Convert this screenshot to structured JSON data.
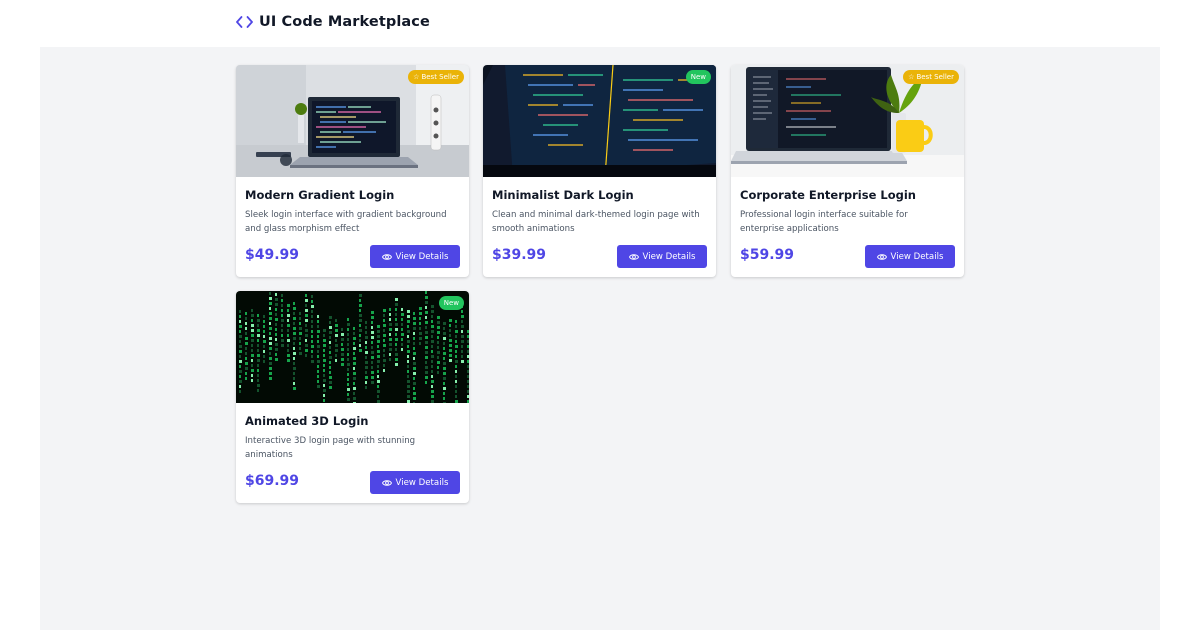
{
  "header": {
    "title": "UI Code Marketplace",
    "icon": "code-icon",
    "accent": "#4f46e5"
  },
  "products": [
    {
      "title": "Modern Gradient Login",
      "description": "Sleek login interface with gradient background and glass morphism effect",
      "price": "$49.99",
      "badge": "Best Seller",
      "badge_icon": "star-icon",
      "button_label": "View Details",
      "button_icon": "eye-icon",
      "image": "laptop-on-desk-photo"
    },
    {
      "title": "Minimalist Dark Login",
      "description": "Clean and minimal dark-themed login page with smooth animations",
      "price": "$39.99",
      "badge": "New",
      "button_label": "View Details",
      "button_icon": "eye-icon",
      "image": "code-on-screen-photo"
    },
    {
      "title": "Corporate Enterprise Login",
      "description": "Professional login interface suitable for enterprise applications",
      "price": "$59.99",
      "badge": "Best Seller",
      "badge_icon": "star-icon",
      "button_label": "View Details",
      "button_icon": "eye-icon",
      "image": "laptop-with-plant-and-mug-photo"
    },
    {
      "title": "Animated 3D Login",
      "description": "Interactive 3D login page with stunning animations",
      "price": "$69.99",
      "badge": "New",
      "button_label": "View Details",
      "button_icon": "eye-icon",
      "image": "matrix-code-rain-photo"
    }
  ],
  "colors": {
    "primary": "#4f46e5",
    "best_seller_badge": "#eab308",
    "new_badge": "#22c55e",
    "background": "#f3f4f6"
  }
}
